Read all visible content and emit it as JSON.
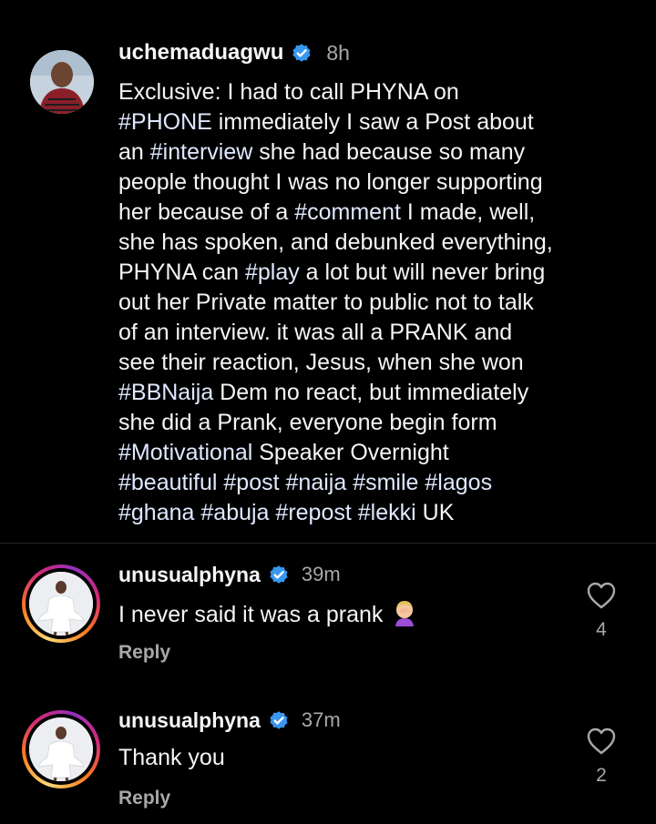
{
  "post": {
    "username": "uchemaduagwu",
    "time": "8h",
    "lines": [
      [
        {
          "t": "Exclusive: I had to call PHYNA on"
        }
      ],
      [
        {
          "t": "#PHONE",
          "h": true
        },
        {
          "t": " immediately I saw a Post about"
        }
      ],
      [
        {
          "t": "an "
        },
        {
          "t": "#interview",
          "h": true
        },
        {
          "t": " she had because so many"
        }
      ],
      [
        {
          "t": "people thought I was no longer supporting"
        }
      ],
      [
        {
          "t": "her because of a "
        },
        {
          "t": "#comment",
          "h": true
        },
        {
          "t": " I made, well,"
        }
      ],
      [
        {
          "t": "she has spoken, and debunked everything,"
        }
      ],
      [
        {
          "t": "PHYNA can "
        },
        {
          "t": "#play",
          "h": true
        },
        {
          "t": " a lot but will never bring"
        }
      ],
      [
        {
          "t": "out her Private matter to public not to talk"
        }
      ],
      [
        {
          "t": "of an interview. it was all a PRANK and"
        }
      ],
      [
        {
          "t": "see their reaction, Jesus, when she won"
        }
      ],
      [
        {
          "t": "#BBNaija",
          "h": true
        },
        {
          "t": " Dem no react, but immediately"
        }
      ],
      [
        {
          "t": "she did a Prank, everyone begin form"
        }
      ],
      [
        {
          "t": "#Motivational",
          "h": true
        },
        {
          "t": " Speaker Overnight"
        }
      ],
      [
        {
          "t": "#beautiful",
          "h": true
        },
        {
          "t": " "
        },
        {
          "t": "#post",
          "h": true
        },
        {
          "t": " "
        },
        {
          "t": "#naija",
          "h": true
        },
        {
          "t": " "
        },
        {
          "t": "#smile",
          "h": true
        },
        {
          "t": " "
        },
        {
          "t": "#lagos",
          "h": true
        }
      ],
      [
        {
          "t": "#ghana",
          "h": true
        },
        {
          "t": " "
        },
        {
          "t": "#abuja",
          "h": true
        },
        {
          "t": " "
        },
        {
          "t": "#repost",
          "h": true
        },
        {
          "t": " "
        },
        {
          "t": "#lekki",
          "h": true
        },
        {
          "t": " UK"
        }
      ]
    ]
  },
  "comments": [
    {
      "username": "unusualphyna",
      "time": "39m",
      "text": "I never said it was a prank",
      "emoji": "facepalm-emoji",
      "likes": "4",
      "reply": "Reply"
    },
    {
      "username": "unusualphyna",
      "time": "37m",
      "text": "Thank you",
      "likes": "2",
      "reply": "Reply"
    }
  ],
  "colors": {
    "background": "#000000",
    "text": "#f5f5f5",
    "secondary": "#a8a8a8",
    "hashtag": "#dfe8ff",
    "verified": "#3897f0"
  }
}
